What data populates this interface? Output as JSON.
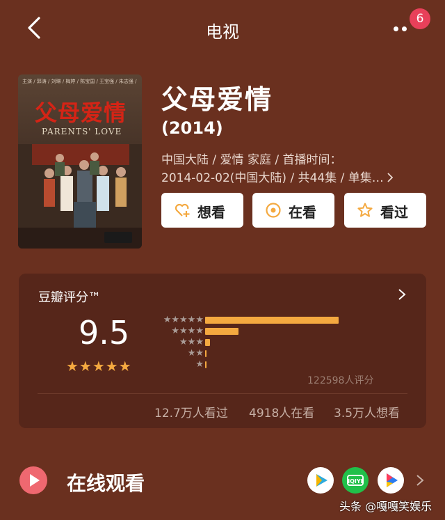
{
  "header": {
    "title": "电视",
    "badge": "6"
  },
  "poster": {
    "credits": "主演 / 郭涛 / 刘琳 / 梅婷 / 陈宝国 / 王宝强 / 朱志强 / 胡亚捷",
    "title": "父母爱情",
    "subtitle": "PARENTS' LOVE"
  },
  "drama": {
    "title": "父母爱情",
    "year": "(2014)",
    "meta_line1": "中国大陆 / 爱情 家庭 / 首播时间：",
    "meta_line2": "2014-02-02(中国大陆) / 共44集 / 单集…"
  },
  "actions": [
    {
      "label": "想看",
      "icon": "heart-plus-icon"
    },
    {
      "label": "在看",
      "icon": "target-circle-icon"
    },
    {
      "label": "看过",
      "icon": "star-outline-icon"
    }
  ],
  "rating": {
    "title": "豆瓣评分™",
    "score": "9.5",
    "stars": "★★★★★",
    "distribution": [
      {
        "stars": "★★★★★",
        "fraction": 1.0
      },
      {
        "stars": "★★★★",
        "fraction": 0.25
      },
      {
        "stars": "★★★",
        "fraction": 0.035
      },
      {
        "stars": "★★",
        "fraction": 0.004
      },
      {
        "stars": "★",
        "fraction": 0.004
      }
    ],
    "count_label": "122598人评分",
    "stats": [
      "12.7万人看过",
      "4918人在看",
      "3.5万人想看"
    ]
  },
  "online": {
    "title": "在线观看",
    "apps": [
      "iqiyi-app-icon",
      "tencent-video-icon",
      "youku-icon"
    ]
  },
  "watermark": "头条 @嘎嘎笑娱乐",
  "colors": {
    "background": "#6a301f",
    "card": "#56261a",
    "accent": "#f4a940",
    "badge": "#e8405a",
    "play": "#ef6870"
  }
}
